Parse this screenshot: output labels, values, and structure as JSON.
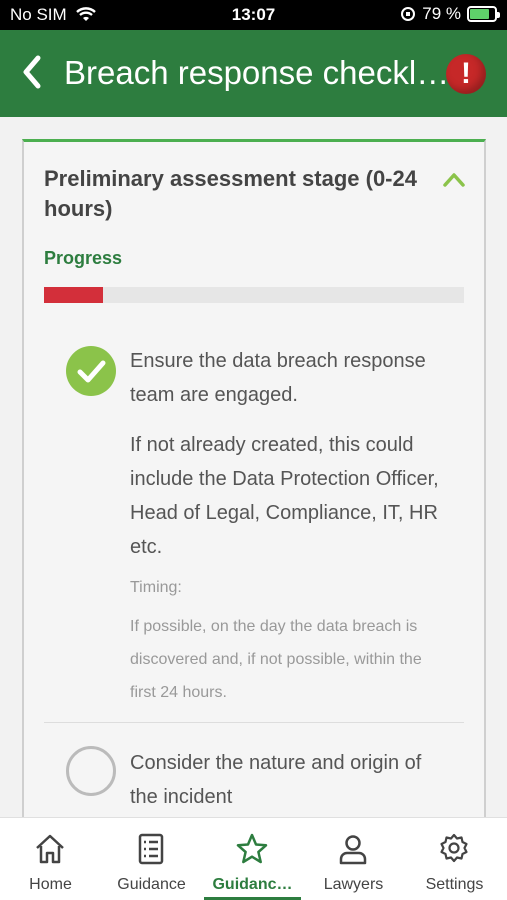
{
  "status_bar": {
    "carrier": "No SIM",
    "time": "13:07",
    "battery": "79 %",
    "battery_level": 0.79
  },
  "header": {
    "title": "Breach response checkl…",
    "alert_symbol": "!"
  },
  "card": {
    "title": "Preliminary assessment stage (0-24 hours)",
    "progress_label": "Progress",
    "progress_value": 0.14,
    "items": [
      {
        "completed": true,
        "text": "Ensure the data breach response team are engaged.",
        "note": "If not already created, this could include the Data Protection Officer, Head of Legal, Compliance, IT, HR etc.",
        "timing_label": "Timing:",
        "timing": "If possible, on the day the data breach is discovered and, if not possible, within the first 24 hours."
      },
      {
        "completed": false,
        "text": "Consider the nature and origin of the incident"
      }
    ]
  },
  "tabs": [
    {
      "label": "Home",
      "icon": "home-icon",
      "active": false
    },
    {
      "label": "Guidance",
      "icon": "list-icon",
      "active": false
    },
    {
      "label": "Guidanc…",
      "icon": "star-icon",
      "active": true
    },
    {
      "label": "Lawyers",
      "icon": "person-icon",
      "active": false
    },
    {
      "label": "Settings",
      "icon": "gear-icon",
      "active": false
    }
  ],
  "colors": {
    "brand": "#2d7d3f",
    "progress": "#d32f3a",
    "check": "#8bc34a",
    "alert": "#c62828"
  }
}
